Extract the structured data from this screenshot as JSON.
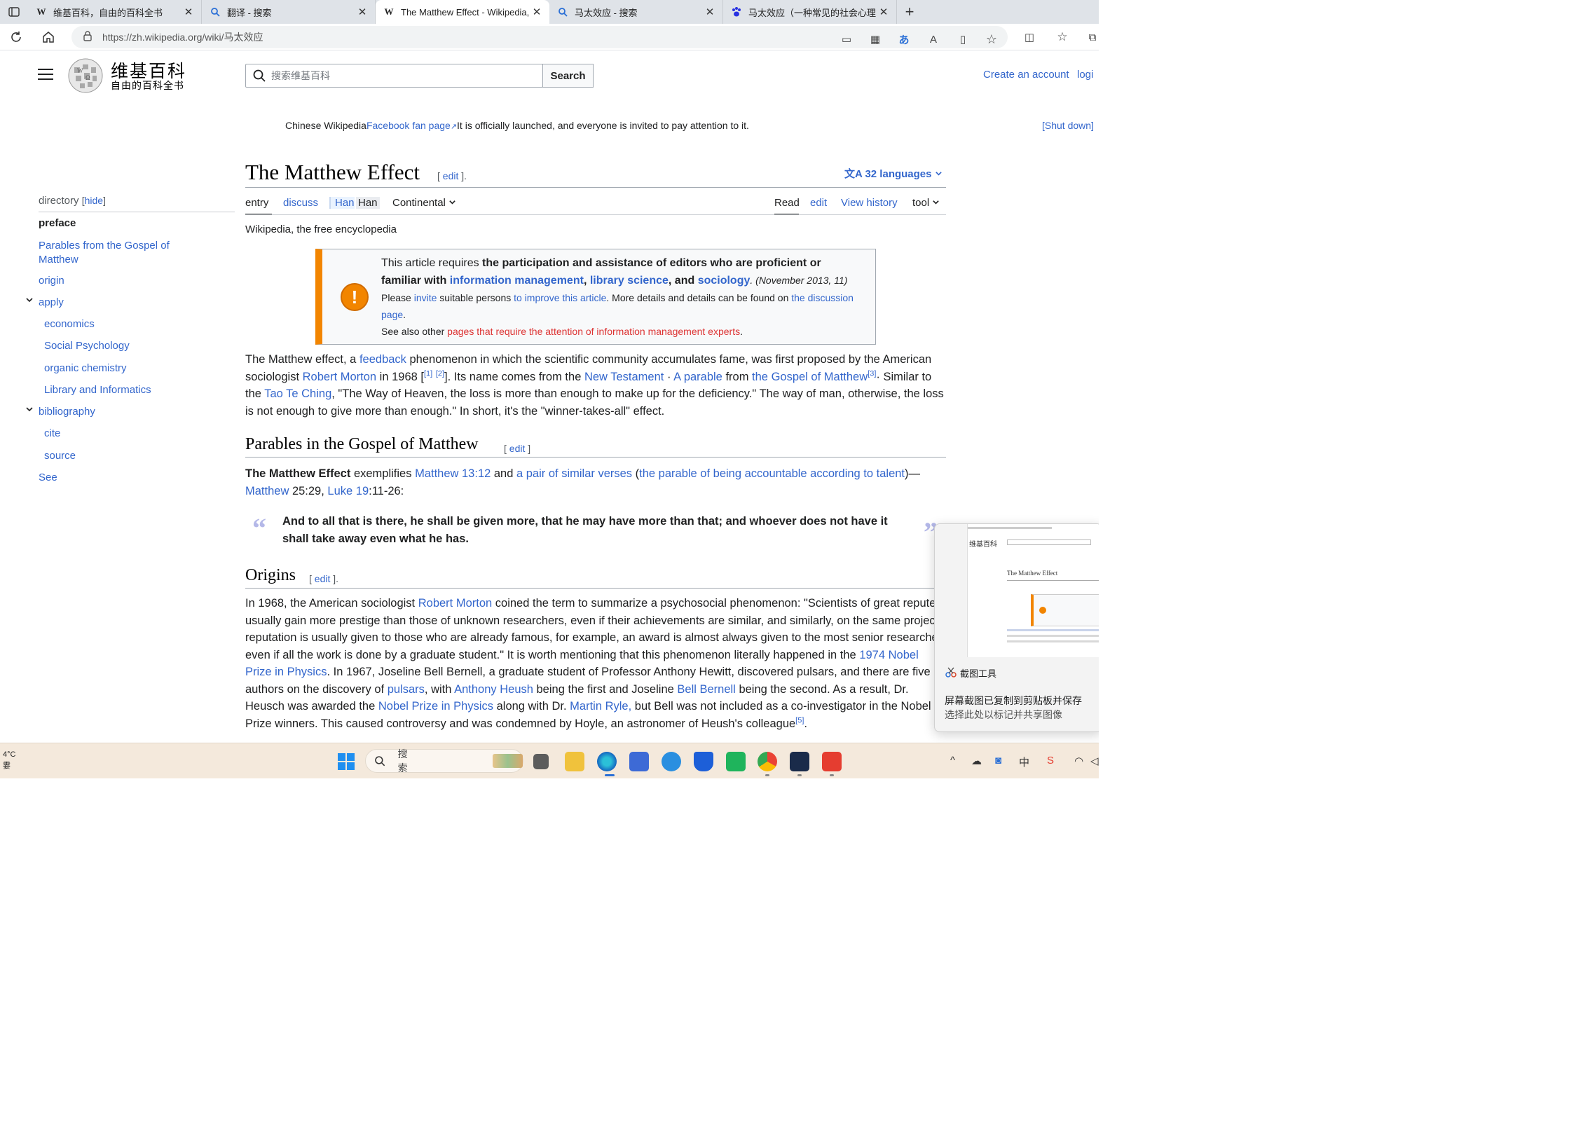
{
  "browser": {
    "tabs": [
      {
        "favicon": "W",
        "title": "维基百科，自由的百科全书"
      },
      {
        "favicon": "search-icon",
        "title": "翻译 - 搜索"
      },
      {
        "favicon": "W",
        "title": "The Matthew Effect - Wikipedia, t"
      },
      {
        "favicon": "search-icon",
        "title": "马太效应 - 搜索"
      },
      {
        "favicon": "paw-icon",
        "title": "马太效应（一种常见的社会心理"
      }
    ],
    "active_tab": 2,
    "url": "https://zh.wikipedia.org/wiki/马太效应"
  },
  "header": {
    "logo_title": "维基百科",
    "logo_subtitle": "自由的百科全书",
    "search_placeholder": "搜索维基百科",
    "search_button": "Search",
    "create_account": "Create an account",
    "login": "logi"
  },
  "notice": {
    "prefix": "Chinese Wikipedia",
    "link": "Facebook fan page",
    "suffix": "It is officially launched, and everyone is invited to pay attention to it.",
    "shutdown": "[Shut down]"
  },
  "toc": {
    "heading": "directory",
    "hide": "hide",
    "items": [
      {
        "label": "preface",
        "level": 0,
        "current": true
      },
      {
        "label": "Parables from the Gospel of Matthew",
        "level": 0
      },
      {
        "label": "origin",
        "level": 0
      },
      {
        "label": "apply",
        "level": 0,
        "expandable": true
      },
      {
        "label": "economics",
        "level": 1
      },
      {
        "label": "Social Psychology",
        "level": 1
      },
      {
        "label": "organic chemistry",
        "level": 1
      },
      {
        "label": "Library and Informatics",
        "level": 1
      },
      {
        "label": "bibliography",
        "level": 0,
        "expandable": true
      },
      {
        "label": "cite",
        "level": 1
      },
      {
        "label": "source",
        "level": 1
      },
      {
        "label": "See",
        "level": 0
      }
    ]
  },
  "article": {
    "title": "The Matthew Effect",
    "title_edit": "edit",
    "languages": "32 languages",
    "tabs_left": [
      "entry",
      "discuss"
    ],
    "han1": "Han",
    "han2": "Han",
    "variant": "Continental",
    "tabs_right": [
      "Read",
      "edit",
      "View history",
      "tool"
    ],
    "tagline": "Wikipedia, the free encyclopedia"
  },
  "ambox": {
    "l1a": "This article requires ",
    "l1b": "the participation and assistance of editors who are proficient or",
    "l2a": "familiar with ",
    "l2_link1": "information management",
    "l2_comma": ", ",
    "l2_link2": "library science",
    "l2_and": ", and ",
    "l2_link3": "sociology",
    "l2_date": ". (November 2013, 11)",
    "l3a": "Please ",
    "l3_invite": "invite",
    "l3b": " suitable persons ",
    "l3_improve": "to improve this article",
    "l3c": ". More details and details can be found on ",
    "l3_discussion": "the discussion page",
    "l3d": ".",
    "l4a": "See also other ",
    "l4_link": "pages that require the attention of information management experts",
    "l4b": "."
  },
  "intro": {
    "a": "The Matthew effect, a ",
    "feedback": "feedback",
    "b": " phenomenon in which the scientific community accumulates fame, was first proposed by the American sociologist ",
    "morton": "Robert Morton",
    "c": " in 1968 [",
    "ref1": "[1]",
    "ref2": "[2]",
    "d": "]. Its name comes from the ",
    "nt": "New Testament",
    "dot": " · ",
    "parable": "A parable",
    "from": " from ",
    "gospel": "the Gospel of Matthew",
    "ref3": "[3]",
    "e": "· Similar to the ",
    "tao": "Tao Te Ching",
    "f": ", \"The Way of Heaven, the loss is more than enough to make up for the deficiency.\" The way of man, otherwise, the loss is not enough to give more than enough.\" In short, it's the \"winner-takes-all\" effect."
  },
  "section_parables": {
    "heading": "Parables in the Gospel of Matthew",
    "edit": "edit",
    "p_bold": "The Matthew Effect",
    "p_a": " exemplifies ",
    "m1312": "Matthew 13:12",
    "p_b": " and ",
    "similar": "a pair of similar verses",
    "p_c": " (",
    "talent": "the parable of being accountable according to talent",
    "p_d": ")—",
    "matthew": "Matthew",
    "p_e": " 25:29, ",
    "luke": "Luke 19",
    "p_f": ":11-26:",
    "quote": "And to all that is there, he shall be given more, that he may have more than that; and whoever does not have it shall take away even what he has."
  },
  "section_origins": {
    "heading": "Origins",
    "edit": "edit",
    "a": "In 1968, the American sociologist ",
    "morton": "Robert Morton",
    "b": " coined the term to summarize a psychosocial phenomenon: \"Scientists of great repute usually gain more prestige than those of unknown researchers, even if their achievements are similar, and similarly, on the same project, reputation is usually given to those who are already famous, for example, an award is almost always given to the most senior researcher, even if all the work is done by a graduate student.\" It is worth mentioning that this phenomenon literally happened in the ",
    "nobel1974": "1974 Nobel Prize in Physics",
    "c": ". In 1967, Joseline Bell Bernell, a graduate student of Professor Anthony Hewitt, discovered pulsars, and there are five authors on the discovery of ",
    "pulsars": "pulsars",
    "d": ", with ",
    "heush": "Anthony Heush",
    "e": " being the first and Joseline ",
    "bell": "Bell Bernell",
    "f": " being the second. As a result, Dr. Heusch was awarded the ",
    "nobel": "Nobel Prize in Physics",
    "g": " along with Dr. ",
    "ryle": "Martin Ryle,",
    "h": " but Bell was not included as a co-investigator in the Nobel Prize winners. This caused controversy and was condemned by Hoyle, an astronomer of Heush's colleague",
    "ref5": "[5]",
    "i": "."
  },
  "snip_popup": {
    "app": "截图工具",
    "msg1": "屏幕截图已复制到剪贴板并保存",
    "msg2": "选择此处以标记并共享图像",
    "thumb_title": "The Matthew Effect",
    "thumb_logo": "维基百科"
  },
  "taskbar": {
    "temp": "4°C",
    "weather": "霎",
    "search_placeholder": "搜索"
  },
  "colors": {
    "link": "#3366cc",
    "warning": "#f28500",
    "redlink": "#dd3333",
    "taskbar": "#f4e9dc"
  }
}
